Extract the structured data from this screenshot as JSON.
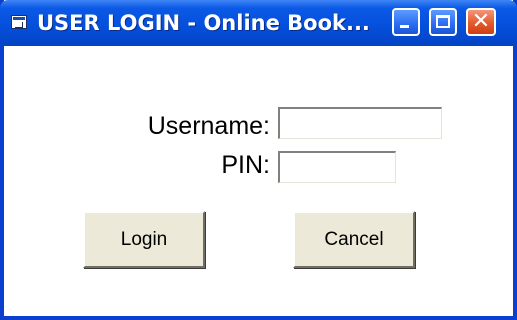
{
  "window": {
    "title": "USER LOGIN - Online Book...",
    "icon": "app-window-icon",
    "controls": {
      "minimize_icon": "minimize-icon",
      "maximize_icon": "maximize-icon",
      "close_icon": "close-icon",
      "close_glyph": "✕"
    }
  },
  "form": {
    "username_label": "Username:",
    "username_value": "",
    "pin_label": "PIN:",
    "pin_value": ""
  },
  "buttons": {
    "login_label": "Login",
    "cancel_label": "Cancel"
  },
  "colors": {
    "titlebar": "#0550dc",
    "frame": "#0a3fcf",
    "close_button": "#e35a2b",
    "button_face": "#ece9d8"
  }
}
